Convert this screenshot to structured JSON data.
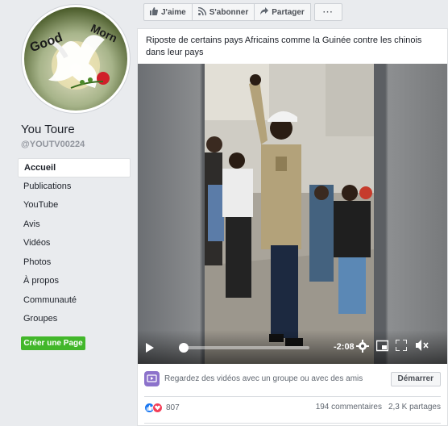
{
  "page": {
    "name": "You Toure",
    "handle": "@YOUTV00224",
    "avatar_text": [
      "Good",
      "Morn"
    ]
  },
  "nav": {
    "items": [
      {
        "label": "Accueil",
        "active": true
      },
      {
        "label": "Publications"
      },
      {
        "label": "YouTube"
      },
      {
        "label": "Avis"
      },
      {
        "label": "Vidéos"
      },
      {
        "label": "Photos"
      },
      {
        "label": "À propos"
      },
      {
        "label": "Communauté"
      },
      {
        "label": "Groupes"
      }
    ],
    "create_page": "Créer une Page"
  },
  "toolbar": {
    "like": "J'aime",
    "follow": "S'abonner",
    "share": "Partager",
    "more": "···"
  },
  "post": {
    "text": "Riposte de certains pays Africains comme la Guinée contre les chinois dans leur pays",
    "video": {
      "time_remaining": "-2:08",
      "progress": 0.03
    },
    "watch_party": {
      "text": "Regardez des vidéos avec un groupe ou avec des amis",
      "button": "Démarrer"
    },
    "reactions_count": "807",
    "comments": "194 commentaires",
    "shares": "2,3 K partages"
  },
  "colors": {
    "green_button": "#42b72a",
    "like_blue": "#1877f2",
    "love_red": "#f33e58",
    "watch_purple": "#8c72cb"
  }
}
